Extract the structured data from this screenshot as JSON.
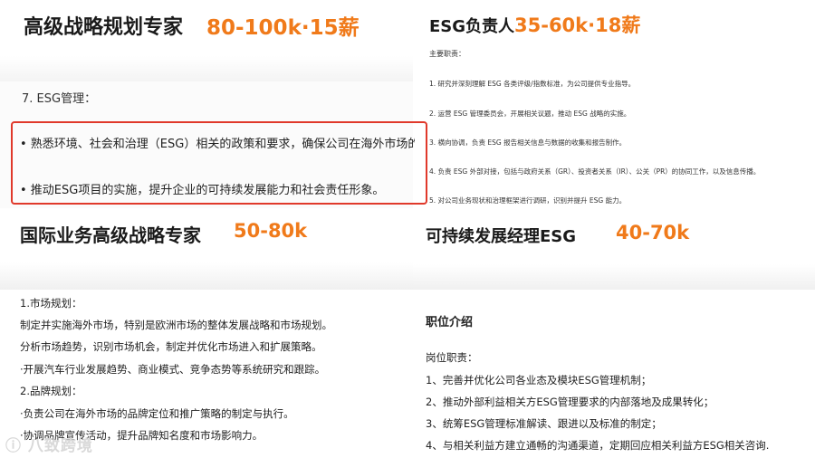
{
  "top_left": {
    "title": "高级战略规划专家",
    "salary": "80-100k·15薪",
    "section": "7. ESG管理：",
    "bullets": [
      "• 熟悉环境、社会和治理（ESG）相关的政策和要求，确保公司在海外市场的运营",
      "• 推动ESG项目的实施，提升企业的可持续发展能力和社会责任形象。"
    ]
  },
  "top_right": {
    "title": "ESG负责人",
    "salary": "35-60k·18薪",
    "heading": "主要职责：",
    "items": [
      "1. 研究并深刻理解 ESG 各类评级/指数标准，为公司提供专业指导。",
      "2. 运营 ESG 管理委员会，开展相关议题，推动 ESG 战略的实施。",
      "3. 横向协调，负责 ESG 报告相关信息与数据的收集和报告制作。",
      "4. 负责 ESG 外部对接，包括与政府关系（GR）、投资者关系（IR）、公关（PR）的协同工作，以及信息传播。",
      "5. 对公司业务现状和治理框架进行调研，识别并提升 ESG 能力。"
    ]
  },
  "bottom_left": {
    "title": "国际业务高级战略专家",
    "salary": "50-80k",
    "lines": [
      "1.市场规划：",
      "制定并实施海外市场，特别是欧洲市场的整体发展战略和市场规划。",
      "分析市场趋势，识别市场机会，制定并优化市场进入和扩展策略。",
      "·开展汽车行业发展趋势、商业模式、竞争态势等系统研究和跟踪。",
      "2.品牌规划：",
      "·负责公司在海外市场的品牌定位和推广策略的制定与执行。",
      "·协调品牌宣传活动，提升品牌知名度和市场影响力。"
    ]
  },
  "bottom_right": {
    "title": "可持续发展经理ESG",
    "salary": "40-70k",
    "intro_heading": "职位介绍",
    "duty_heading": "岗位职责：",
    "items": [
      "1、完善并优化公司各业态及模块ESG管理机制；",
      "2、推动外部利益相关方ESG管理要求的内部落地及成果转化；",
      "3、统筹ESG管理标准解读、跟进以及标准的制定；",
      "4、与相关利益方建立通畅的沟通渠道，定期回应相关利益方ESG相关咨询."
    ]
  },
  "watermark": "ⓘ 八致跨境"
}
